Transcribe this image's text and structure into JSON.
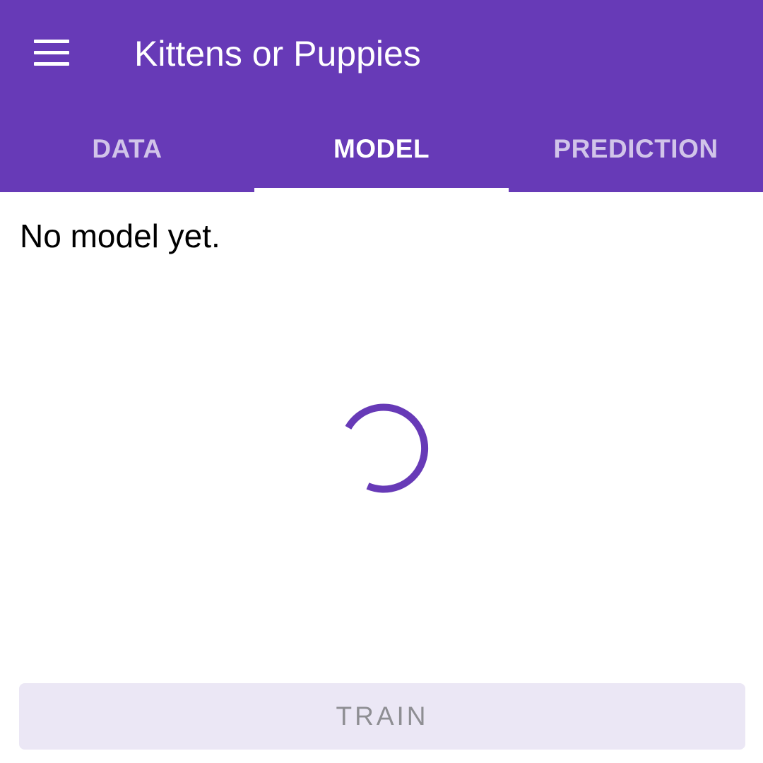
{
  "app": {
    "title": "Kittens or Puppies",
    "accent_color": "#673AB7",
    "menu_icon": "hamburger-menu-icon"
  },
  "tabs": [
    {
      "label": "DATA",
      "active": false
    },
    {
      "label": "MODEL",
      "active": true
    },
    {
      "label": "PREDICTION",
      "active": false
    }
  ],
  "main": {
    "status_text": "No model yet.",
    "loading_icon": "progress-spinner-icon"
  },
  "actions": {
    "train_label": "TRAIN",
    "train_enabled": false
  }
}
